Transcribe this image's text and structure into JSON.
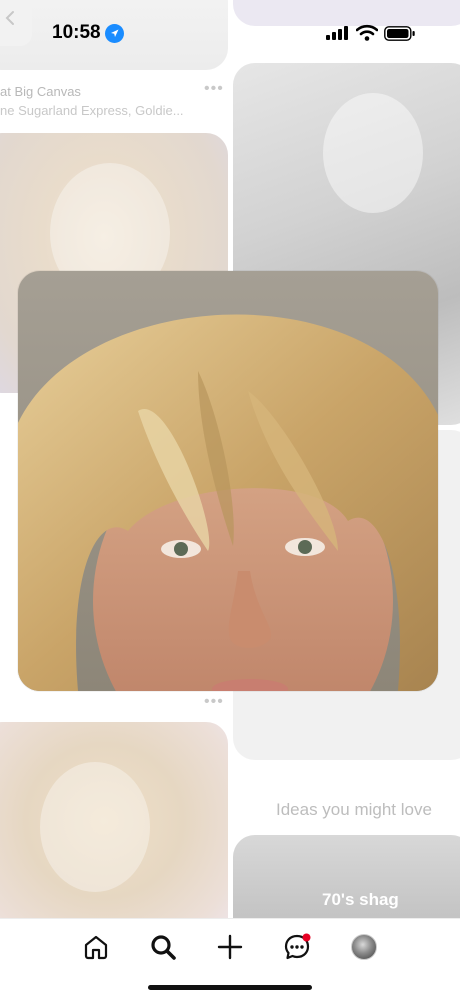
{
  "status_bar": {
    "time": "10:58"
  },
  "feed": {
    "pins": [
      {
        "title": "at Big Canvas",
        "subtitle": "ne Sugarland Express, Goldie..."
      }
    ],
    "section_title": "Ideas you might love",
    "idea_label": "70's shag"
  },
  "tabbar": {
    "items": [
      {
        "icon": "home-icon"
      },
      {
        "icon": "search-icon"
      },
      {
        "icon": "plus-icon"
      },
      {
        "icon": "messages-icon",
        "badge": true
      },
      {
        "icon": "profile-avatar"
      }
    ],
    "badge_color": "#e60023"
  },
  "colors": {
    "background": "#ffffff",
    "nav_icon": "#111111",
    "location_blue": "#1a8cff"
  }
}
